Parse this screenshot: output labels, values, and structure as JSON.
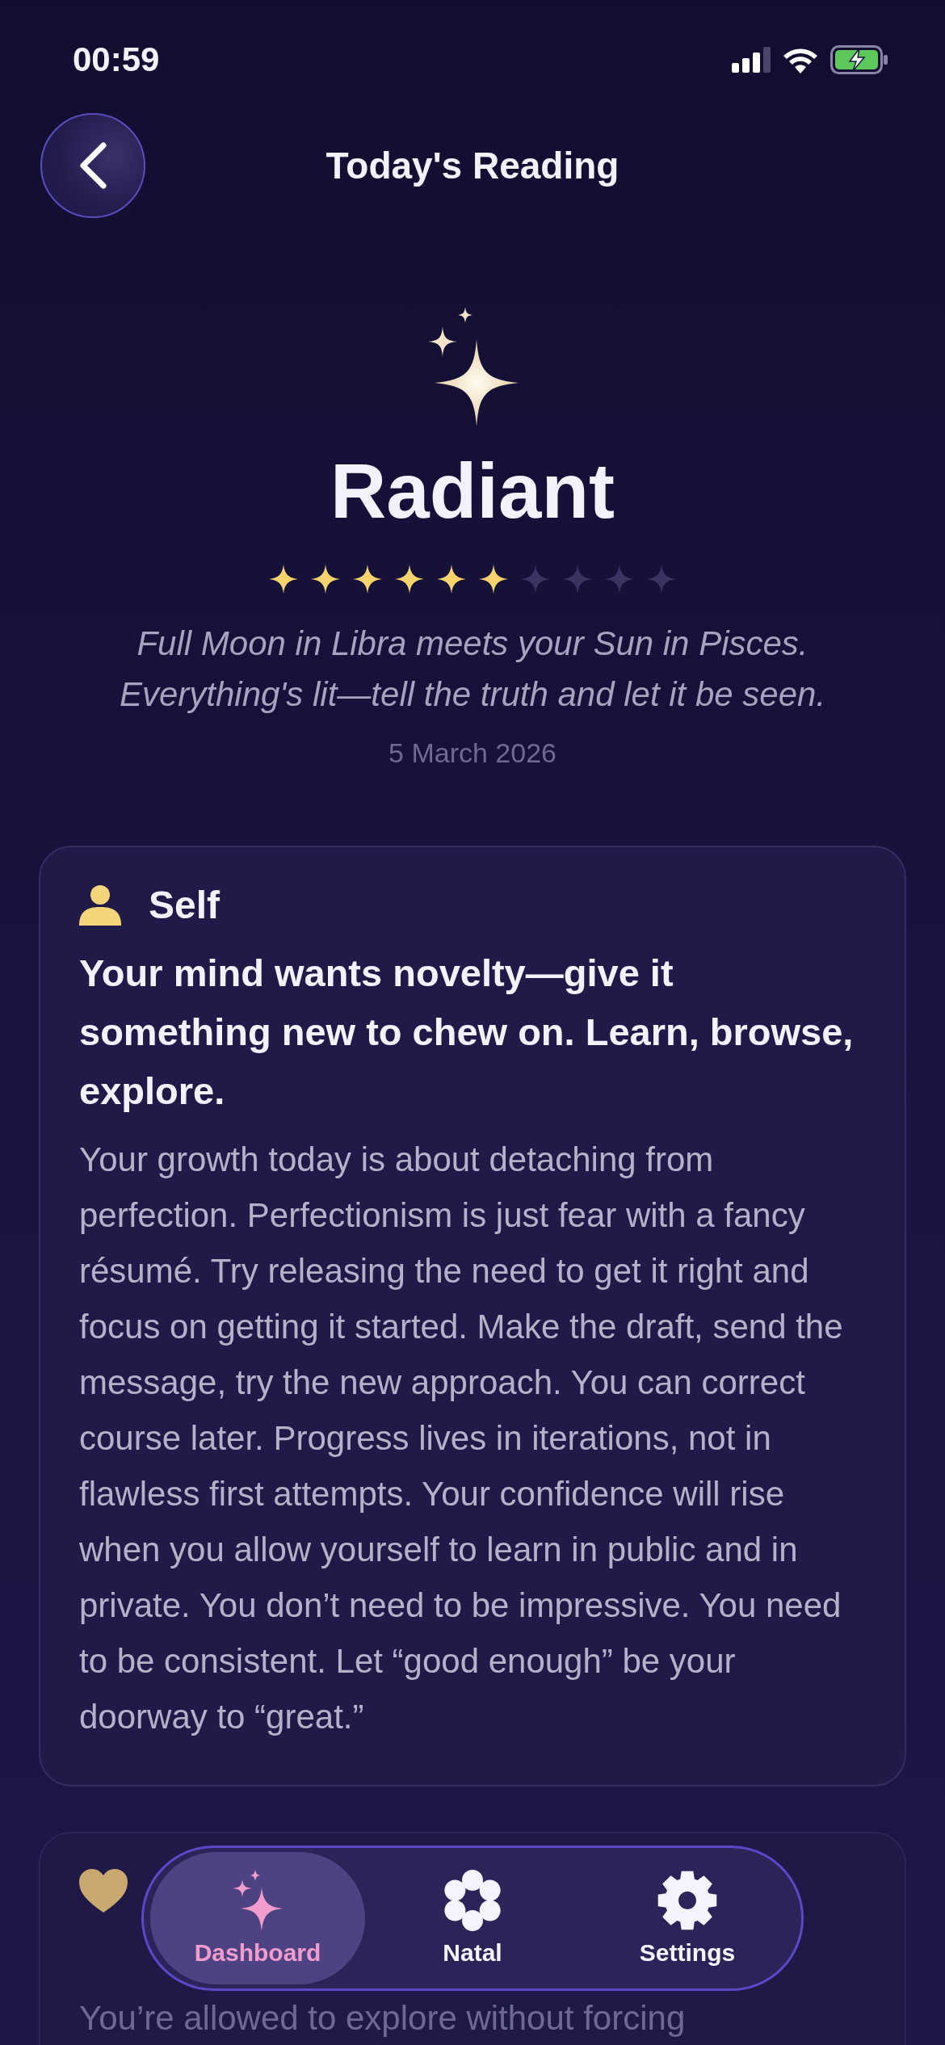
{
  "status_bar": {
    "time": "00:59"
  },
  "header": {
    "title": "Today's Reading"
  },
  "hero": {
    "title": "Radiant",
    "stars": 6,
    "subtitle": "Full Moon in Libra meets your Sun in Pisces. Everything's lit—tell the truth and let it be seen.",
    "date": "5 March 2026"
  },
  "cards": [
    {
      "kind": "person",
      "title": "Self",
      "headline": "Your mind wants novelty—give it something new to chew on. Learn, browse, explore.",
      "body": "Your growth today is about detaching from perfection. Perfectionism is just fear with a fancy résumé. Try releasing the need to get it right and focus on getting it started. Make the draft, send the message, try the new approach. You can correct course later. Progress lives in iterations, not in flawless first attempts. Your confidence will rise when you allow yourself to learn in public and in private. You don’t need to be impressive. You need to be consistent. Let “good enough” be your doorway to “great.”"
    },
    {
      "kind": "heart",
      "body": "You’re allowed to explore without forcing"
    }
  ],
  "tab_bar": [
    {
      "kind": "sparkle",
      "label": "Dashboard",
      "selected": true
    },
    {
      "kind": "flower",
      "label": "Natal",
      "selected": false
    },
    {
      "kind": "gear",
      "label": "Settings",
      "selected": false
    }
  ]
}
